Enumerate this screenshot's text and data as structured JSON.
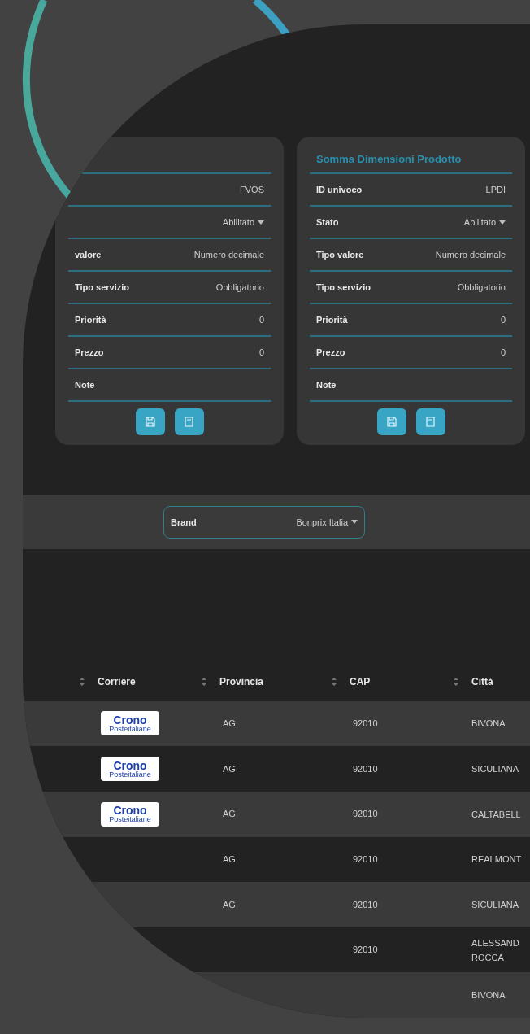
{
  "cards": [
    {
      "rows": [
        {
          "label": null,
          "value": "FVOS",
          "kind": "text"
        },
        {
          "label": null,
          "value": "Abilitato",
          "kind": "select"
        },
        {
          "label": "valore",
          "value": "Numero decimale",
          "kind": "text"
        },
        {
          "label": "Tipo servizio",
          "value": "Obbligatorio",
          "kind": "text"
        },
        {
          "label": "Priorità",
          "value": "0",
          "kind": "text"
        },
        {
          "label": "Prezzo",
          "value": "0",
          "kind": "text"
        },
        {
          "label": "Note",
          "value": null,
          "kind": "text"
        }
      ]
    },
    {
      "title": "Somma Dimensioni Prodotto",
      "rows": [
        {
          "label": "ID univoco",
          "value": "LPDI",
          "kind": "text"
        },
        {
          "label": "Stato",
          "value": "Abilitato",
          "kind": "select"
        },
        {
          "label": "Tipo valore",
          "value": "Numero decimale",
          "kind": "text"
        },
        {
          "label": "Tipo servizio",
          "value": "Obbligatorio",
          "kind": "text"
        },
        {
          "label": "Priorità",
          "value": "0",
          "kind": "text"
        },
        {
          "label": "Prezzo",
          "value": "0",
          "kind": "text"
        },
        {
          "label": "Note",
          "value": null,
          "kind": "text"
        }
      ]
    }
  ],
  "brand": {
    "label": "Brand",
    "value": "Bonprix Italia"
  },
  "table": {
    "columns": [
      "Corriere",
      "Provincia",
      "CAP",
      "Città"
    ],
    "rows": [
      {
        "logo": {
          "name": "Crono",
          "sub": "Posteitaliane"
        },
        "provincia": "AG",
        "cap": "92010",
        "citta": "BIVONA"
      },
      {
        "logo": {
          "name": "Crono",
          "sub": "Posteitaliane"
        },
        "provincia": "AG",
        "cap": "92010",
        "citta": "SICULIANA"
      },
      {
        "logo": {
          "name": "Crono",
          "sub": "Posteitaliane"
        },
        "provincia": "AG",
        "cap": "92010",
        "citta": "CALTABELL"
      },
      {
        "logo": null,
        "provincia": "AG",
        "cap": "92010",
        "citta": "REALMONT"
      },
      {
        "logo": null,
        "provincia": "AG",
        "cap": "92010",
        "citta": "SICULIANA"
      },
      {
        "logo": null,
        "provincia": null,
        "cap": "92010",
        "citta": "ALESSAND ROCCA"
      },
      {
        "logo": null,
        "provincia": null,
        "cap": null,
        "citta": "BIVONA"
      }
    ]
  }
}
